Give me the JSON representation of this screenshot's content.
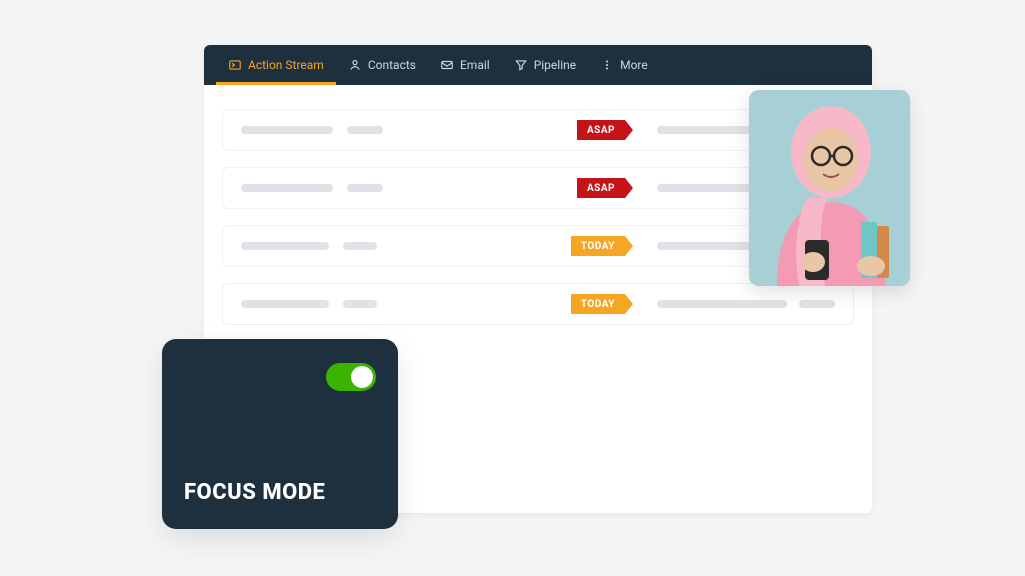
{
  "nav": {
    "items": [
      {
        "label": "Action Stream",
        "icon": "stream-icon",
        "active": true
      },
      {
        "label": "Contacts",
        "icon": "person-icon",
        "active": false
      },
      {
        "label": "Email",
        "icon": "mail-icon",
        "active": false
      },
      {
        "label": "Pipeline",
        "icon": "funnel-icon",
        "active": false
      },
      {
        "label": "More",
        "icon": "more-icon",
        "active": false
      }
    ]
  },
  "stream": {
    "rows": [
      {
        "tag": "ASAP",
        "tag_color": "red"
      },
      {
        "tag": "ASAP",
        "tag_color": "red"
      },
      {
        "tag": "TODAY",
        "tag_color": "orange"
      },
      {
        "tag": "TODAY",
        "tag_color": "orange"
      }
    ]
  },
  "focus_card": {
    "label": "FOCUS MODE",
    "toggle_on": true
  },
  "colors": {
    "navbar_bg": "#1e2f3e",
    "accent": "#f5a623",
    "tag_red": "#c4141a",
    "tag_orange": "#f5a623",
    "toggle_green": "#3bb300"
  }
}
